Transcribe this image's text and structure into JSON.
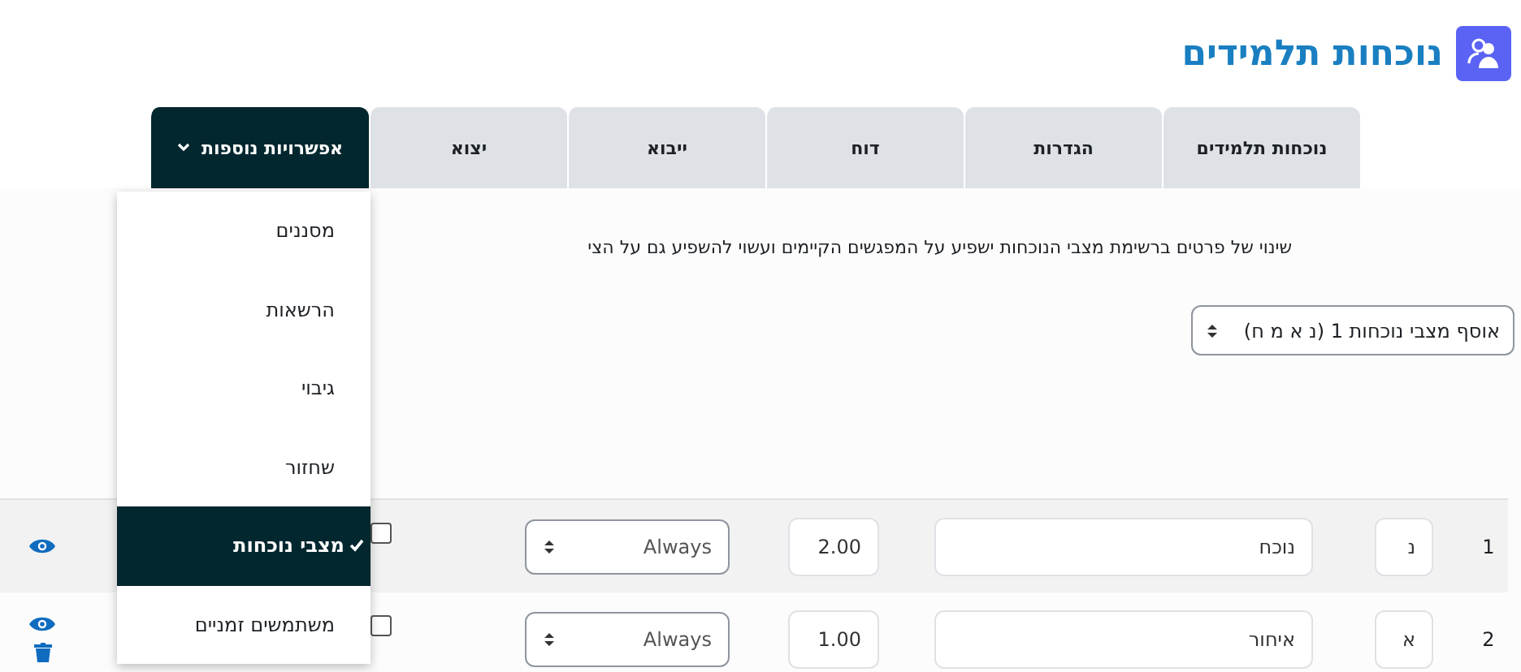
{
  "header": {
    "title": "נוכחות תלמידים"
  },
  "tabs": [
    {
      "label": "נוכחות תלמידים",
      "kind": "tab",
      "selected": false
    },
    {
      "label": "הגדרות",
      "kind": "tab",
      "selected": false
    },
    {
      "label": "דוח",
      "kind": "tab",
      "selected": false
    },
    {
      "label": "ייבוא",
      "kind": "tab",
      "selected": false
    },
    {
      "label": "יצוא",
      "kind": "tab",
      "selected": false
    },
    {
      "label": "אפשרויות נוספות",
      "kind": "menu",
      "selected": true
    }
  ],
  "menu": {
    "open": true,
    "items": [
      {
        "label": "מסננים",
        "selected": false
      },
      {
        "label": "הרשאות",
        "selected": false
      },
      {
        "label": "גיבוי",
        "selected": false
      },
      {
        "label": "שחזור",
        "selected": false
      },
      {
        "label": "מצבי נוכחות",
        "selected": true
      },
      {
        "label": "משתמשים זמניים",
        "selected": false
      }
    ]
  },
  "notice": "שינוי של פרטים ברשימת מצבי הנוכחות ישפיע על המפגשים הקיימים ועשוי להשפיע גם על הצי",
  "set_select": {
    "value": "אוסף מצבי נוכחות 1 (נ א מ ח)"
  },
  "rows": [
    {
      "number": "1",
      "acronym": "נ",
      "description": "נוכח",
      "grade": "2.00",
      "availability": "Always",
      "checked": false,
      "deletable": false
    },
    {
      "number": "2",
      "acronym": "א",
      "description": "איחור",
      "grade": "1.00",
      "availability": "Always",
      "checked": false,
      "deletable": true
    }
  ]
}
